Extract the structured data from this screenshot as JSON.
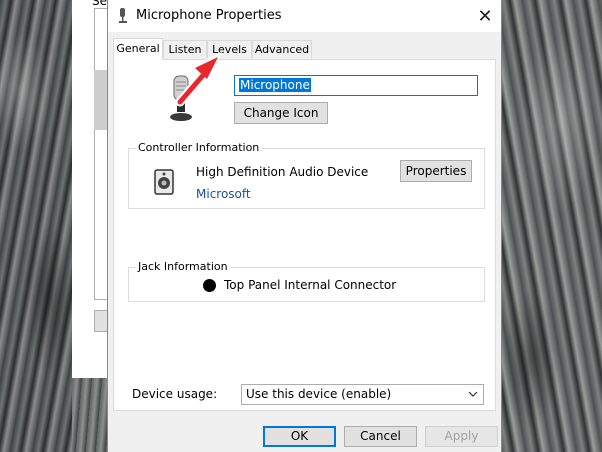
{
  "background_window": {
    "title_fragment": "Se"
  },
  "dialog": {
    "title": "Microphone Properties",
    "close_glyph": "✕",
    "tabs": [
      {
        "label": "General",
        "active": true
      },
      {
        "label": "Listen",
        "active": false
      },
      {
        "label": "Levels",
        "active": false
      },
      {
        "label": "Advanced",
        "active": false
      }
    ],
    "device_name": "Microphone",
    "change_icon_label": "Change Icon",
    "controller": {
      "group_label": "Controller Information",
      "device": "High Definition Audio Device",
      "vendor": "Microsoft",
      "properties_label": "Properties"
    },
    "jack": {
      "group_label": "Jack Information",
      "connector": "Top Panel Internal Connector"
    },
    "device_usage": {
      "label": "Device usage:",
      "selected": "Use this device (enable)"
    },
    "buttons": {
      "ok": "OK",
      "cancel": "Cancel",
      "apply": "Apply"
    }
  },
  "colors": {
    "accent": "#0078d7",
    "annotation_arrow": "#e8262b",
    "vendor_link": "#1e4e9a"
  },
  "icons": {
    "title": "microphone-icon",
    "device": "microphone-icon",
    "controller": "speaker-icon",
    "jack": "jack-dot-icon",
    "dropdown": "chevron-down-icon"
  }
}
